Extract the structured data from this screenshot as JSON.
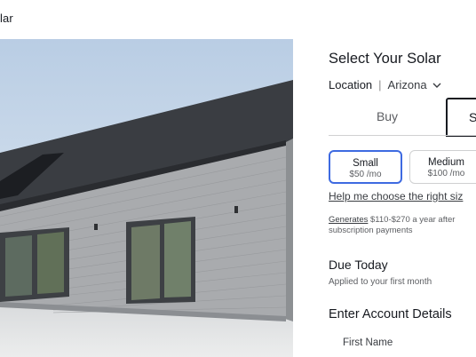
{
  "header": {
    "brand_fragment": "lar"
  },
  "hero": {
    "image": "solar-house-photo",
    "sky_color": "#c9d8ea",
    "roof_color": "#3a3d42",
    "siding_color": "#a9abae"
  },
  "panel": {
    "title": "Select Your Solar",
    "location": {
      "label": "Location",
      "separator": "|",
      "value": "Arizona"
    },
    "tabs": [
      {
        "label": "Buy",
        "active": false
      },
      {
        "label": "S",
        "active": true
      }
    ],
    "options": [
      {
        "name": "Small",
        "price": "$50 /mo",
        "selected": true
      },
      {
        "name": "Medium",
        "price": "$100 /mo",
        "selected": false
      }
    ],
    "help_link": "Help me choose the right siz",
    "generates": {
      "link": "Generates",
      "text_line1": " $110-$270 a year after",
      "text_line2": "subscription payments"
    },
    "due_today": {
      "title": "Due Today",
      "subtitle": "Applied to your first month"
    },
    "account": {
      "title": "Enter Account Details",
      "first_name_label": "First Name"
    }
  },
  "colors": {
    "accent": "#3e6ae1",
    "text": "#171a20",
    "muted": "#5c5e62",
    "divider": "#d0d1d2"
  }
}
